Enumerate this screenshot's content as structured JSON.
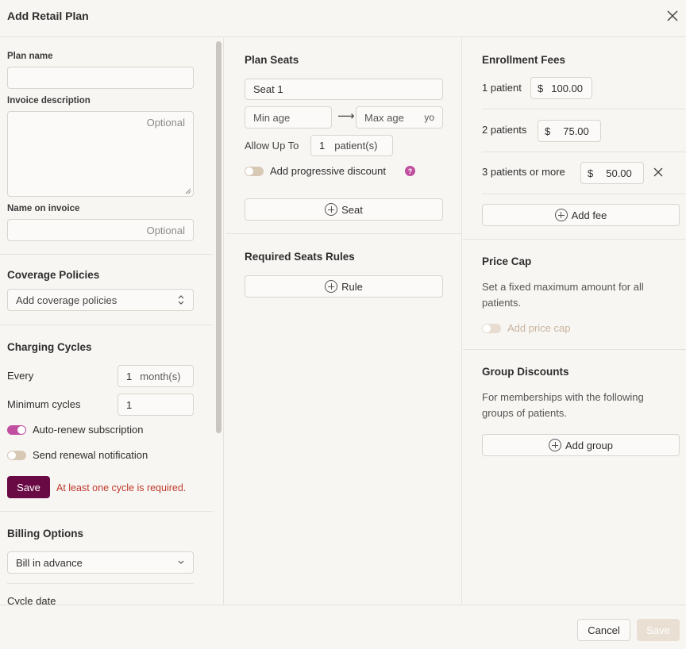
{
  "header": {
    "title": "Add Retail Plan",
    "close_icon": "close-icon"
  },
  "plan": {
    "name_label": "Plan name",
    "name_value": "",
    "invoice_description_label": "Invoice description",
    "invoice_description_placeholder": "Optional",
    "name_on_invoice_label": "Name on invoice",
    "name_on_invoice_placeholder": "Optional"
  },
  "coverage": {
    "title": "Coverage Policies",
    "select_placeholder": "Add coverage policies"
  },
  "charging": {
    "title": "Charging Cycles",
    "every_label": "Every",
    "every_value": "1",
    "every_unit": "month(s)",
    "min_cycles_label": "Minimum cycles",
    "min_cycles_value": "1",
    "auto_renew_label": "Auto-renew subscription",
    "auto_renew_on": true,
    "renewal_notification_label": "Send renewal notification",
    "renewal_notification_on": false,
    "save_label": "Save",
    "error": "At least one cycle is required."
  },
  "billing": {
    "title": "Billing Options",
    "selected": "Bill in advance",
    "cycle_date_label": "Cycle date"
  },
  "seats": {
    "title": "Plan Seats",
    "seat_name": "Seat 1",
    "min_age_placeholder": "Min age",
    "arrow": "⟶",
    "max_age_placeholder": "Max age",
    "age_unit": "yo",
    "allow_label": "Allow Up To",
    "allow_value": "1",
    "allow_unit": "patient(s)",
    "progressive_label": "Add progressive discount",
    "help": "?",
    "add_seat_label": "Seat"
  },
  "rules": {
    "title": "Required Seats Rules",
    "add_rule_label": "Rule"
  },
  "fees": {
    "title": "Enrollment Fees",
    "currency": "$",
    "items": [
      {
        "label": "1 patient",
        "amount": "100.00"
      },
      {
        "label": "2 patients",
        "amount": "75.00"
      },
      {
        "label": "3 patients or more",
        "amount": "50.00"
      }
    ],
    "add_fee_label": "Add fee"
  },
  "price_cap": {
    "title": "Price Cap",
    "description": "Set a fixed maximum amount for all patients.",
    "toggle_label": "Add price cap"
  },
  "group_discounts": {
    "title": "Group Discounts",
    "description": "For memberships with the following groups of patients.",
    "add_group_label": "Add group"
  },
  "footer": {
    "cancel_label": "Cancel",
    "save_label": "Save"
  },
  "colors": {
    "accent": "#c04fa0",
    "primary": "#6a0a45",
    "error": "#c0392b"
  }
}
